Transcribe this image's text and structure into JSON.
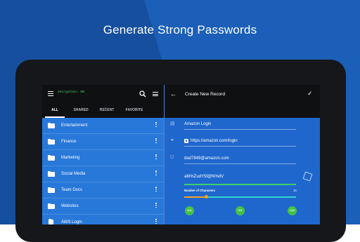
{
  "headline": "Generate Strong Passwords",
  "app": {
    "status": "encryption: ON",
    "tabs": [
      "ALL",
      "SHARED",
      "RECENT",
      "FAVORITE"
    ],
    "folders": [
      "Entertainment",
      "Finance",
      "Marketing",
      "Social Media",
      "Team Docs",
      "Websites",
      "AWS Login"
    ]
  },
  "record": {
    "title": "Create New Record",
    "name": "Amazon Login",
    "url": "https://amazon.com/login",
    "username": "dad7849@amazon.com",
    "password": "a6t%ZudY5f@N%dV",
    "length_label": "Number of Characters",
    "length_value": "16",
    "options": [
      "A-Z",
      "0-9",
      "!@#"
    ]
  },
  "icons": {
    "menu": "hamburger-icon",
    "search": "search-icon",
    "view": "list-view-icon",
    "back": "back-arrow-icon",
    "save": "check-icon",
    "generate": "dice-icon"
  },
  "colors": {
    "accent": "#1e66c9",
    "strength": "#3fcf6a",
    "slider_active": "#f2a51e",
    "chip": "#45c246"
  }
}
